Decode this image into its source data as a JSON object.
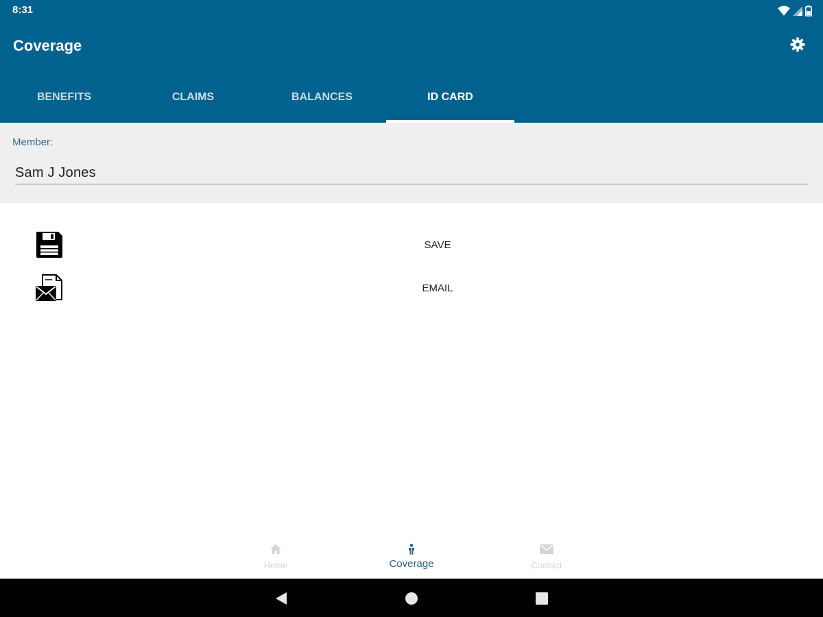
{
  "status_bar": {
    "time": "8:31"
  },
  "toolbar": {
    "title": "Coverage"
  },
  "tabs": [
    {
      "label": "BENEFITS",
      "active": false
    },
    {
      "label": "CLAIMS",
      "active": false
    },
    {
      "label": "BALANCES",
      "active": false
    },
    {
      "label": "ID CARD",
      "active": true
    }
  ],
  "member": {
    "label": "Member:",
    "value": "Sam J Jones"
  },
  "actions": {
    "save": {
      "label": "SAVE",
      "icon": "floppy-disk-icon"
    },
    "email": {
      "label": "EMAIL",
      "icon": "envelope-document-icon"
    }
  },
  "bottom_nav": [
    {
      "label": "Home",
      "icon": "home-icon",
      "active": false
    },
    {
      "label": "Coverage",
      "icon": "person-icon",
      "active": true
    },
    {
      "label": "Contact",
      "icon": "envelope-icon",
      "active": false
    }
  ],
  "colors": {
    "header_blue": "#01628f",
    "panel_gray": "#efefef",
    "active_nav": "#2c5f82",
    "inactive_nav": "#d4d4d4"
  }
}
